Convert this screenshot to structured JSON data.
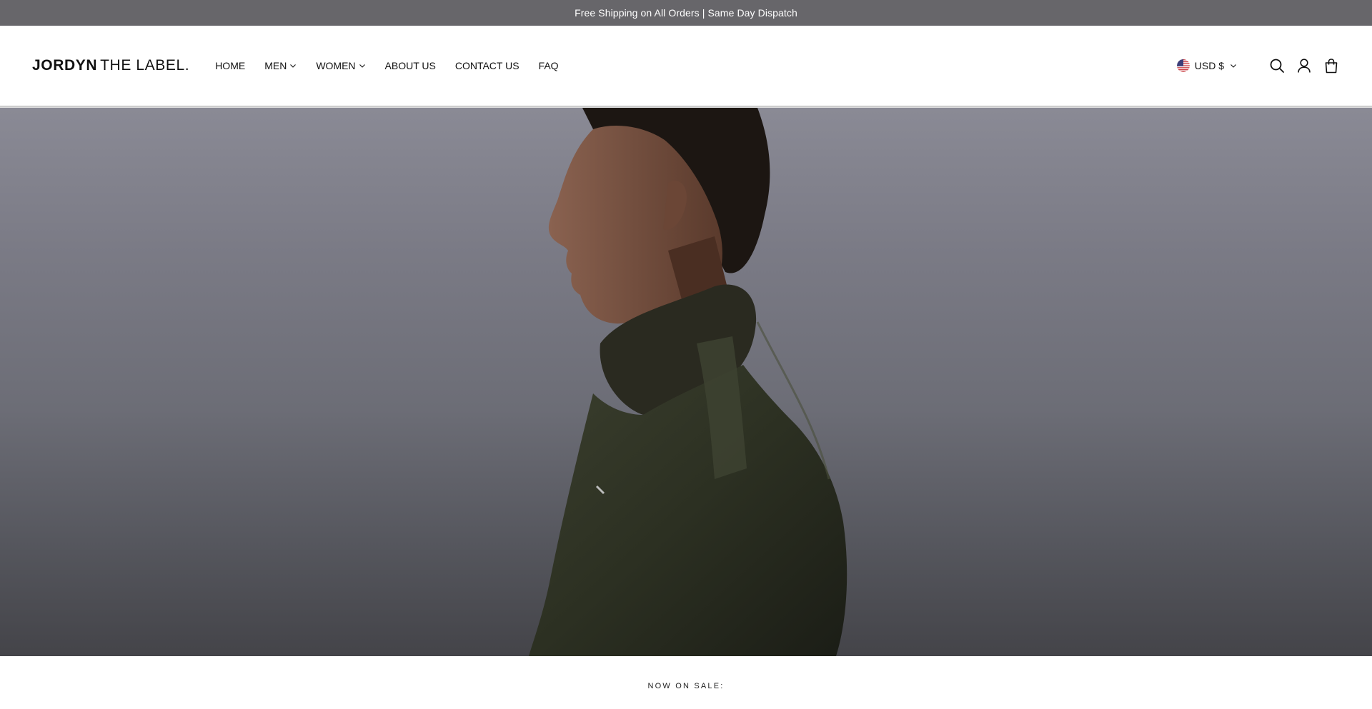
{
  "announcement": {
    "text": "Free Shipping on All Orders | Same Day Dispatch"
  },
  "header": {
    "logo": {
      "bold": "JORDYN",
      "light": "THE LABEL."
    },
    "nav": [
      {
        "label": "HOME",
        "has_dropdown": false
      },
      {
        "label": "MEN",
        "has_dropdown": true
      },
      {
        "label": "WOMEN",
        "has_dropdown": true
      },
      {
        "label": "ABOUT US",
        "has_dropdown": false
      },
      {
        "label": "CONTACT US",
        "has_dropdown": false
      },
      {
        "label": "FAQ",
        "has_dropdown": false
      }
    ],
    "currency": {
      "label": "USD $",
      "flag": "us-flag-icon"
    },
    "icons": [
      "search-icon",
      "account-icon",
      "cart-icon"
    ]
  },
  "hero": {
    "image": "man-in-green-jacket-profile"
  },
  "section": {
    "label": "NOW ON SALE:"
  },
  "colors": {
    "announcement_bg": "#67666a",
    "text": "#111111",
    "hero_bg": "#7b7b86"
  }
}
